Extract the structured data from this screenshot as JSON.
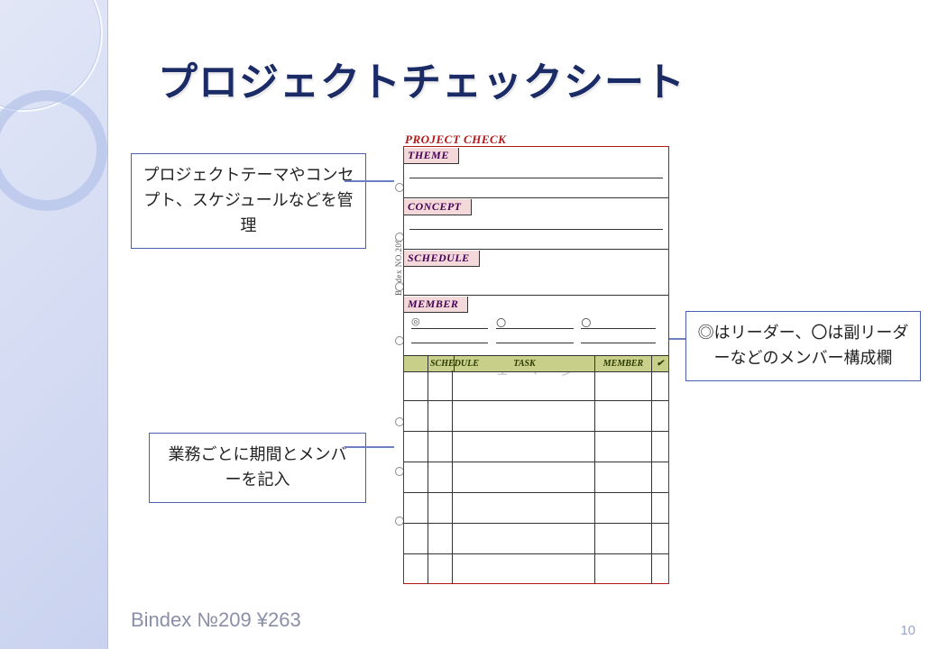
{
  "title": "プロジェクトチェックシート",
  "callouts": {
    "c1": "プロジェクトテーマやコンセプト、スケジュールなどを管理",
    "c2": "業務ごとに期間とメンバーを記入",
    "c3": "◎はリーダー、〇は副リーダーなどのメンバー構成欄"
  },
  "refill": {
    "header": "PROJECT CHECK",
    "sections": {
      "theme": "THEME",
      "concept": "CONCEPT",
      "schedule": "SCHEDULE",
      "member": "MEMBER"
    },
    "member_symbols": {
      "leader": "◎",
      "sub": "〇"
    },
    "task_columns": {
      "schedule": "SCHEDULE",
      "task": "TASK",
      "member": "MEMBER",
      "check": "✔"
    },
    "side_code": "Bindex  NO.209",
    "watermark": "１ ページ"
  },
  "footer": "Bindex №209 ¥263",
  "page_number": "10"
}
